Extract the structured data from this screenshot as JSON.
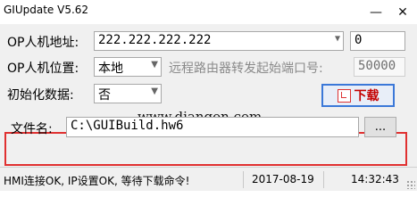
{
  "window": {
    "title": "GIUpdate V5.62"
  },
  "controls": {
    "minimize": "—",
    "close": "✕"
  },
  "op_address": {
    "label": "OP人机地址:",
    "value": "222.222.222.222",
    "port_value": "0"
  },
  "op_position": {
    "label": "OP人机位置:",
    "selected": "本地",
    "remote_port_label": "远程路由器转发起始端口号:",
    "remote_port_value": "50000"
  },
  "init_data": {
    "label": "初始化数据:",
    "selected": "否"
  },
  "watermark": "www.diangon.com",
  "download_button": {
    "label": "下载",
    "icon": "download-icon"
  },
  "file": {
    "label": "文件名:",
    "value": "C:\\GUIBuild.hw6",
    "browse_label": "..."
  },
  "status": {
    "message": "HMI连接OK, IP设置OK, 等待下载命令!",
    "date": "2017-08-19",
    "time": "14:32:43"
  },
  "colors": {
    "highlight_box": "#e03030",
    "download_text": "#c40000"
  }
}
